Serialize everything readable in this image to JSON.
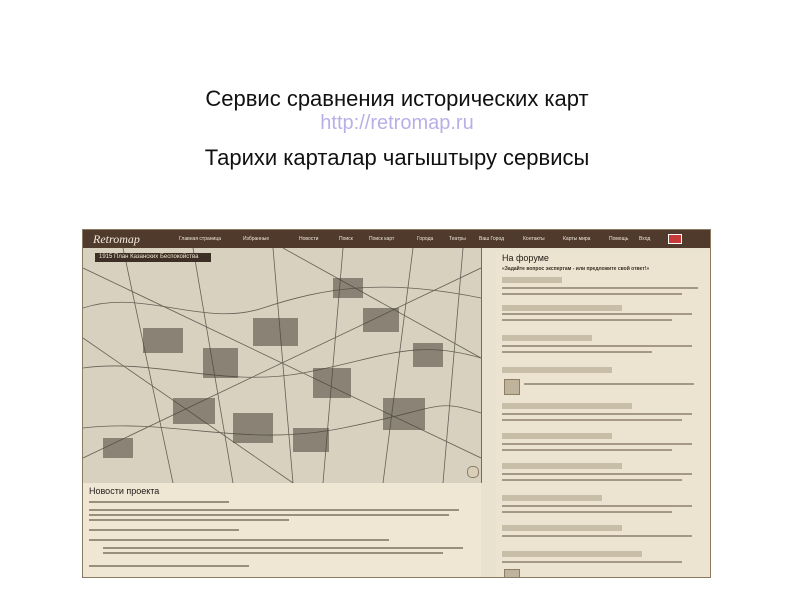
{
  "slide": {
    "title": "Сервис сравнения исторических карт",
    "url": "http://retromap.ru",
    "subtitle_tatar": "Тарихи карталар чагыштыру сервисы"
  },
  "site": {
    "logo": "Retromap",
    "nav": [
      "Главная страница",
      "Избранные",
      "Новости",
      "Поиск",
      "Поиск карт",
      "Города",
      "Театры",
      "Ваш Город",
      "Контакты",
      "Карты мира",
      "Помощь",
      "Вход"
    ],
    "map_caption": "1915 План Казанских Беспокойства",
    "news_title": "Новости проекта",
    "side_title": "На форуме",
    "side_subtitle": "«Задайте вопрос экспертам - или предложите свой ответ!»",
    "colors": {
      "nav_bg": "#4f3a2c",
      "panel_bg": "#ece4d0",
      "link": "#b7b0e6"
    }
  }
}
